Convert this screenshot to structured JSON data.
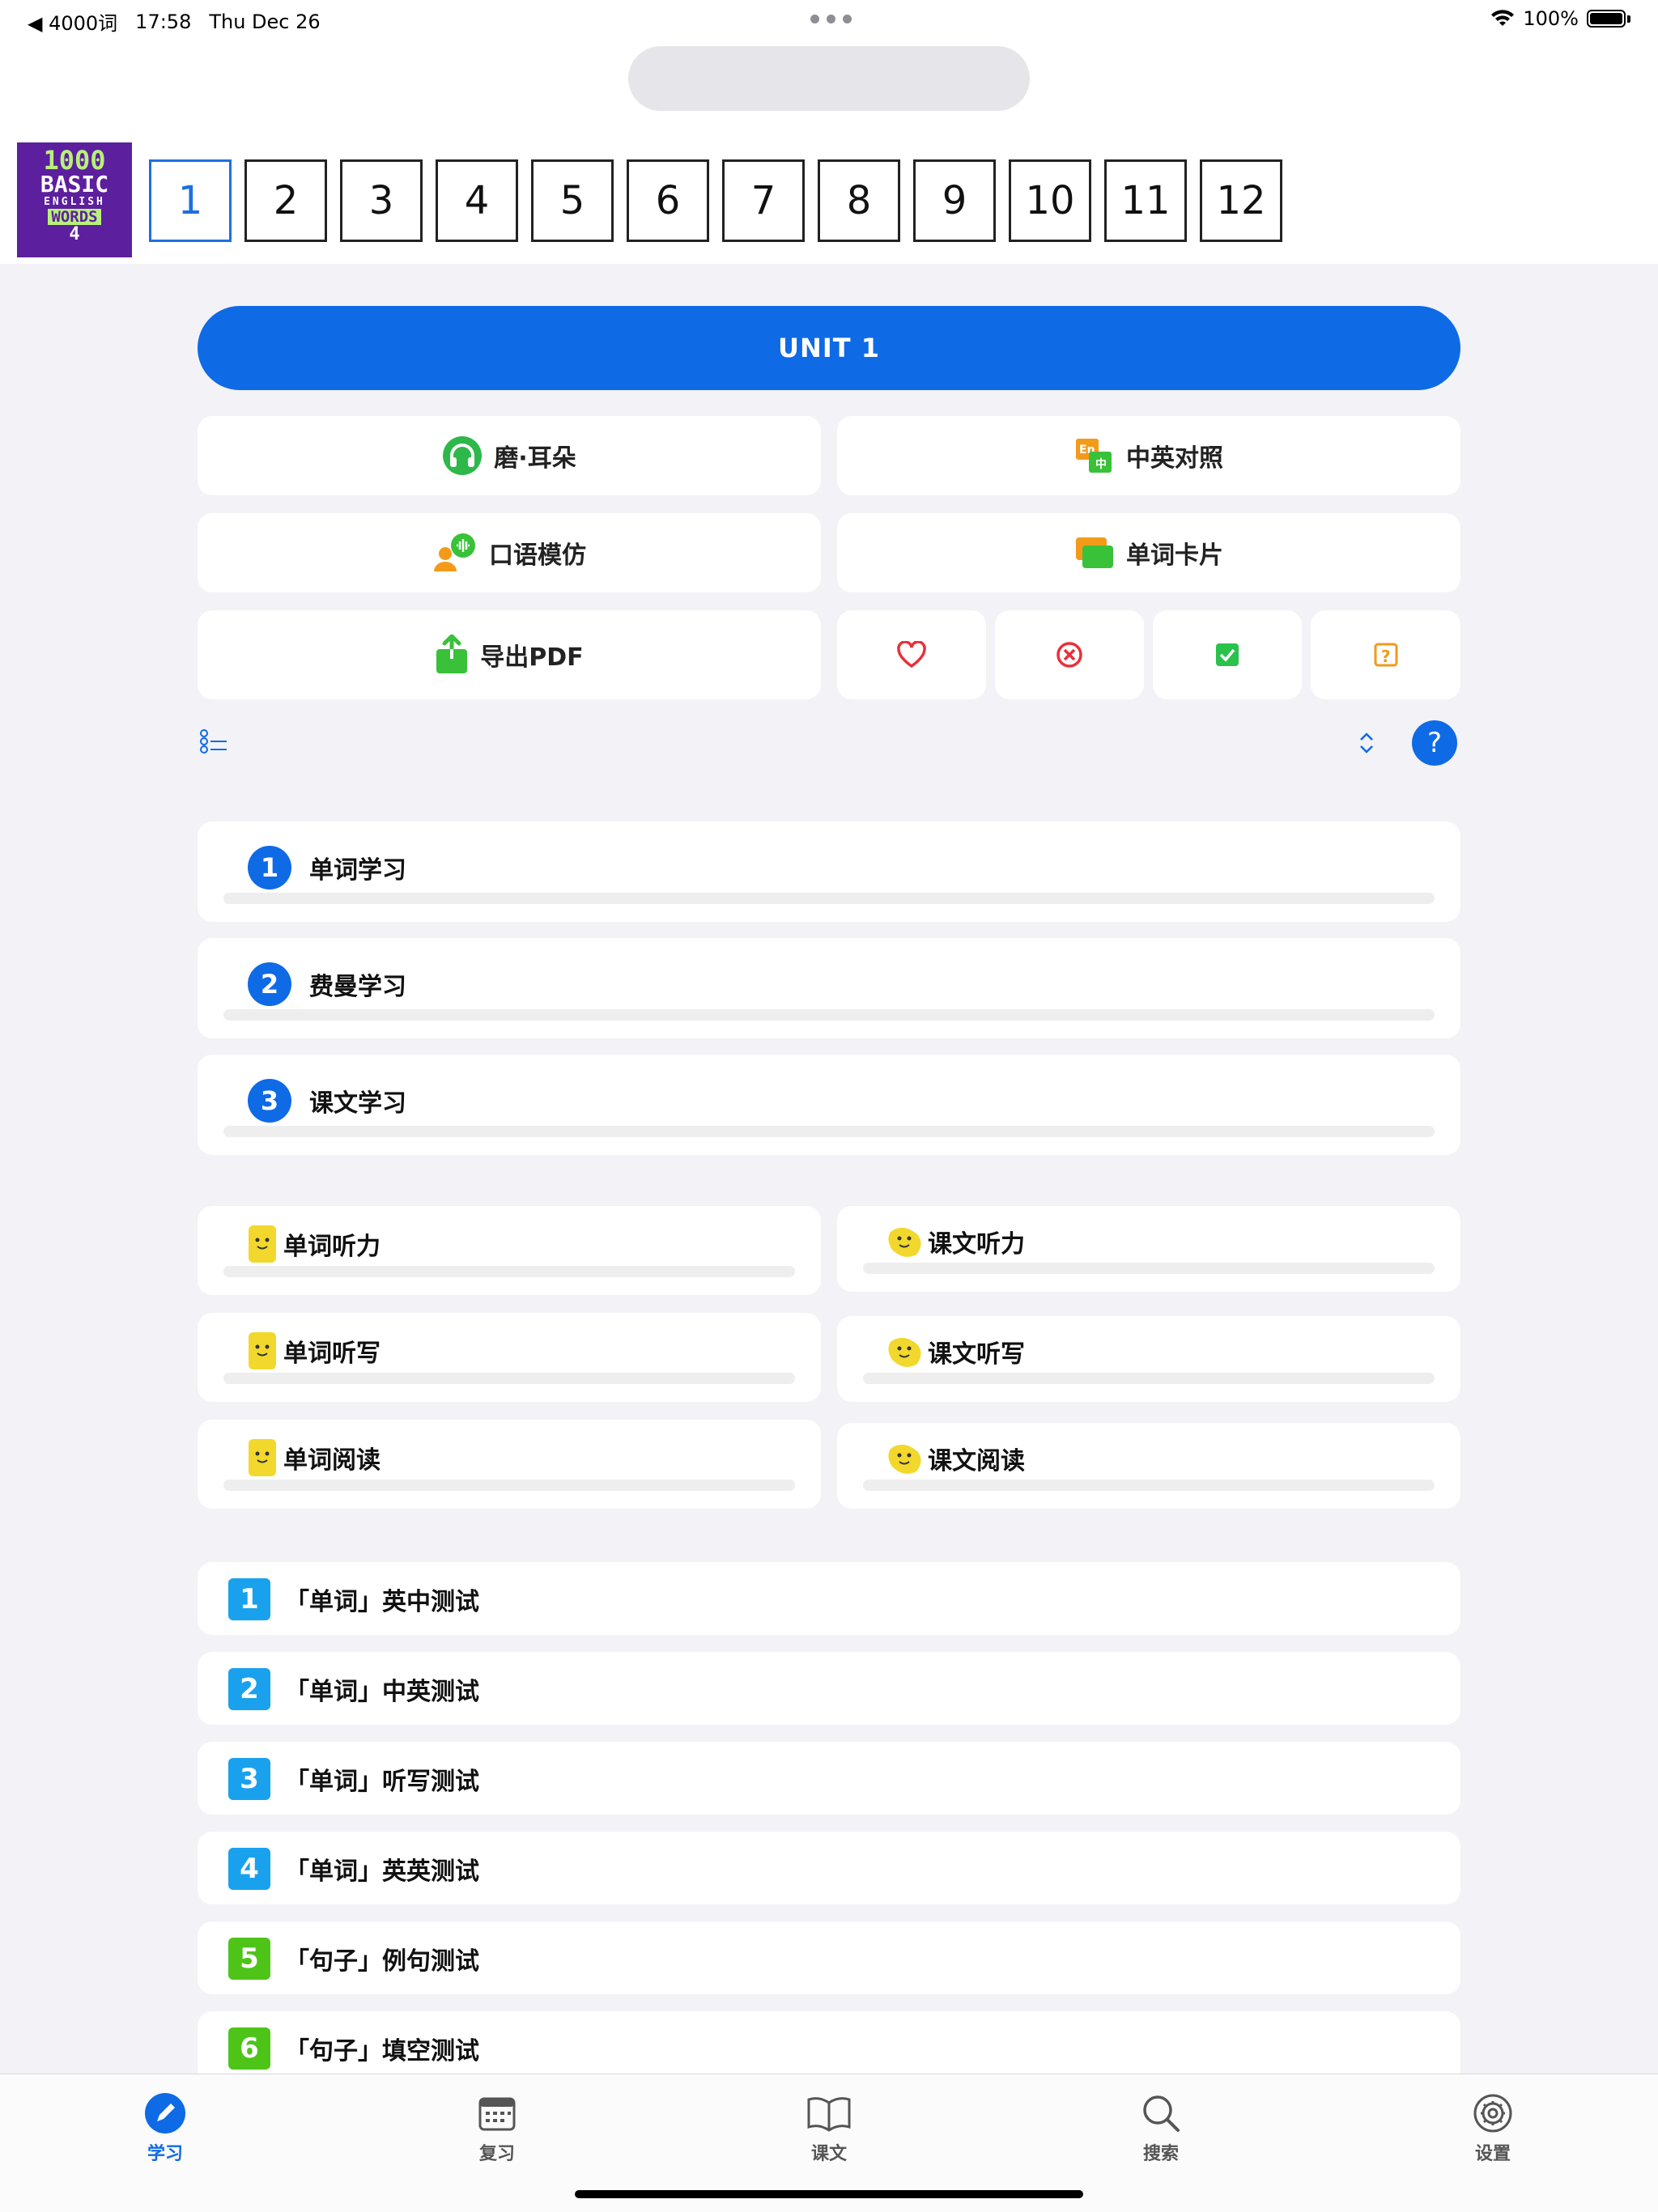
{
  "status_bar": {
    "back_app": "◀ 4000词",
    "time": "17:58",
    "date": "Thu Dec 26",
    "battery": "100%"
  },
  "book_cover": {
    "line1": "1000",
    "line2": "BASIC",
    "line3": "ENGLISH",
    "line4": "WORDS",
    "line5": "4"
  },
  "units": [
    "1",
    "2",
    "3",
    "4",
    "5",
    "6",
    "7",
    "8",
    "9",
    "10",
    "11",
    "12"
  ],
  "active_unit": "1",
  "unit_banner": "UNIT 1",
  "tools": {
    "grind_ears": "磨·耳朵",
    "bilingual": "中英对照",
    "speaking": "口语模仿",
    "flashcards": "单词卡片",
    "export_pdf": "导出PDF"
  },
  "study_steps": [
    {
      "num": "1",
      "label": "单词学习"
    },
    {
      "num": "2",
      "label": "费曼学习"
    },
    {
      "num": "3",
      "label": "课文学习"
    }
  ],
  "practice": {
    "word_listening": "单词听力",
    "text_listening": "课文听力",
    "word_dictation": "单词听写",
    "text_dictation": "课文听写",
    "word_reading": "单词阅读",
    "text_reading": "课文阅读"
  },
  "tests": [
    {
      "num": "1",
      "label": "「单词」英中测试",
      "color": "#1aa1ee"
    },
    {
      "num": "2",
      "label": "「单词」中英测试",
      "color": "#1aa1ee"
    },
    {
      "num": "3",
      "label": "「单词」听写测试",
      "color": "#1aa1ee"
    },
    {
      "num": "4",
      "label": "「单词」英英测试",
      "color": "#1aa1ee"
    },
    {
      "num": "5",
      "label": "「句子」例句测试",
      "color": "#4ec418"
    },
    {
      "num": "6",
      "label": "「句子」填空测试",
      "color": "#4ec418"
    }
  ],
  "tabs": {
    "study": "学习",
    "review": "复习",
    "text": "课文",
    "search": "搜索",
    "settings": "设置"
  },
  "colors": {
    "accent": "#0f6ae6",
    "test_blue": "#1aa1ee",
    "test_green": "#4ec418",
    "favorite": "#e8303a",
    "correct": "#29c24a",
    "unsure": "#f09a1a"
  }
}
